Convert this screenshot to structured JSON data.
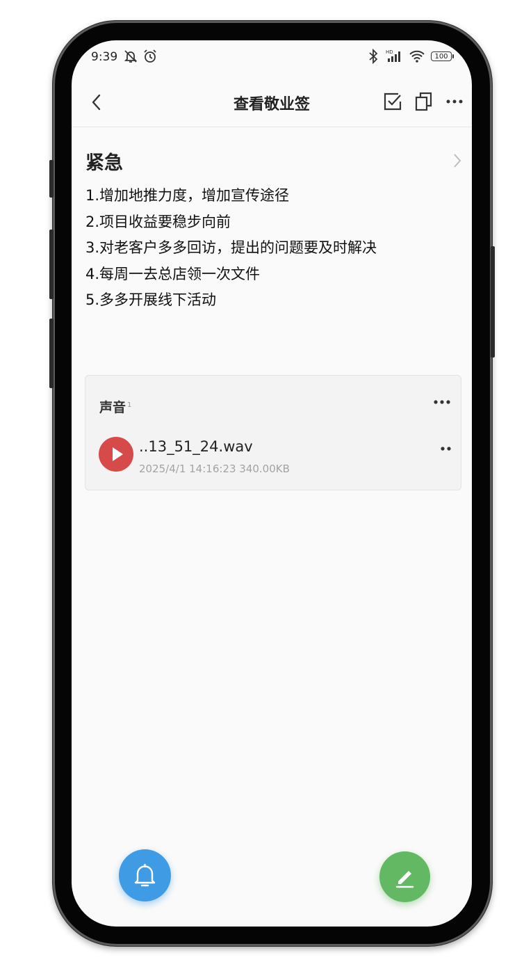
{
  "status_bar": {
    "time": "9:39",
    "battery": "100",
    "icons": [
      "mute-icon",
      "alarm-icon",
      "bluetooth-icon",
      "hd-signal-icon",
      "wifi-icon",
      "battery-icon"
    ]
  },
  "header": {
    "title": "查看敬业签",
    "icons": [
      "back-icon",
      "check-square-icon",
      "copy-icon",
      "more-icon"
    ]
  },
  "note": {
    "title": "紧急",
    "lines": [
      "1.增加地推力度，增加宣传途径",
      "2.项目收益要稳步向前",
      "3.对老客户多多回访，提出的问题要及时解决",
      "4.每周一去总店领一次文件",
      "5.多多开展线下活动"
    ]
  },
  "audio": {
    "header": "声音",
    "count": "1",
    "file": {
      "name": "..13_51_24.wav",
      "meta": "2025/4/1 14:16:23 340.00KB"
    }
  },
  "fab": {
    "left_icon": "bell-icon",
    "right_icon": "edit-icon"
  },
  "colors": {
    "play_button": "#d74a4a",
    "bell_fab": "#3f9ce4",
    "edit_fab": "#63b963"
  }
}
